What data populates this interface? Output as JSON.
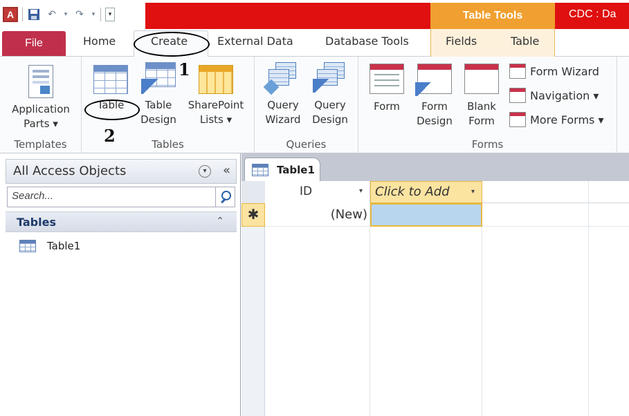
{
  "app": {
    "logo_letter": "A",
    "contextual_group": "Table Tools",
    "db_title": "CDC : Da"
  },
  "tabs": {
    "file": "File",
    "home": "Home",
    "create": "Create",
    "external_data": "External Data",
    "database_tools": "Database Tools",
    "fields": "Fields",
    "table": "Table"
  },
  "annotations": {
    "step1": "1",
    "step2": "2"
  },
  "ribbon": {
    "templates": {
      "label": "Templates",
      "app_parts_line1": "Application",
      "app_parts_line2": "Parts ▾"
    },
    "tables": {
      "label": "Tables",
      "table": "Table",
      "table_design_line1": "Table",
      "table_design_line2": "Design",
      "sharepoint_line1": "SharePoint",
      "sharepoint_line2": "Lists ▾"
    },
    "queries": {
      "label": "Queries",
      "wizard_line1": "Query",
      "wizard_line2": "Wizard",
      "design_line1": "Query",
      "design_line2": "Design"
    },
    "forms": {
      "label": "Forms",
      "form": "Form",
      "form_design_line1": "Form",
      "form_design_line2": "Design",
      "blank_form_line1": "Blank",
      "blank_form_line2": "Form",
      "form_wizard": "Form Wizard",
      "navigation": "Navigation ▾",
      "more_forms": "More Forms ▾"
    }
  },
  "nav_pane": {
    "title": "All Access Objects",
    "shutter": "«",
    "search_placeholder": "Search...",
    "group_label": "Tables",
    "group_chevron": "⌃",
    "items": [
      {
        "label": "Table1"
      }
    ]
  },
  "document": {
    "tab_label": "Table1",
    "columns": [
      "ID",
      "Click to Add"
    ],
    "column_dropdown": "▾",
    "new_row_marker": "✱",
    "new_row_id": "(New)"
  }
}
